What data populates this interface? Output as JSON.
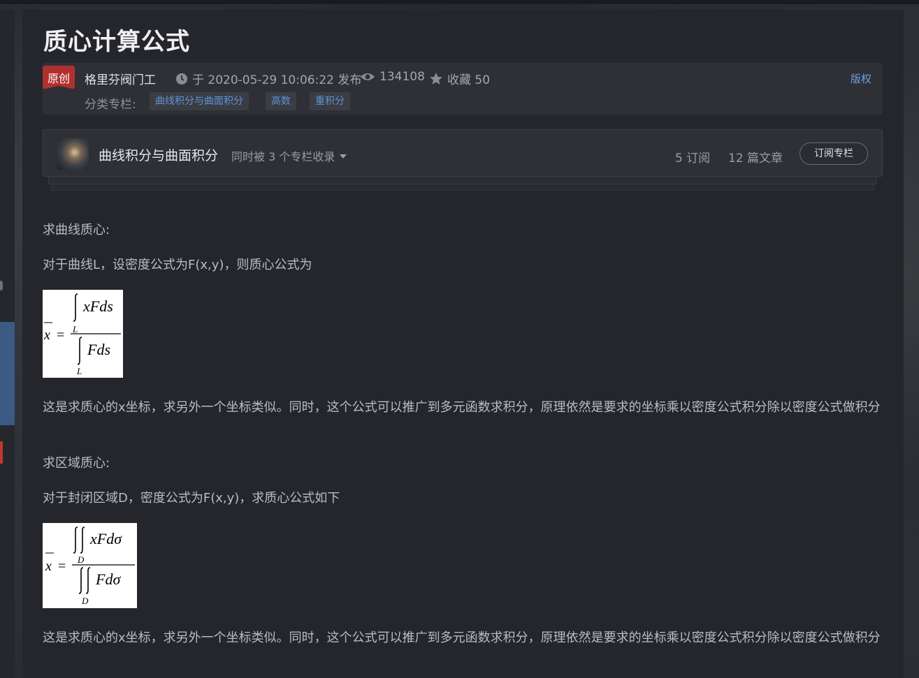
{
  "article": {
    "title": "质心计算公式",
    "meta": {
      "badge": "原创",
      "author": "格里芬阀门工",
      "published": "于 2020-05-29 10:06:22 发布",
      "views": "134108",
      "favorites": "收藏 50",
      "copyright": "版权",
      "category_label": "分类专栏:",
      "tags": [
        "曲线积分与曲面积分",
        "高数",
        "重积分"
      ]
    },
    "column": {
      "name": "曲线积分与曲面积分",
      "also_in": "同时被 3 个专栏收录",
      "subscribers": "5 订阅",
      "articles": "12 篇文章",
      "subscribe_label": "订阅专栏"
    },
    "body": {
      "p1": "求曲线质心:",
      "p2": "对于曲线L，设密度公式为F(x,y)，则质心公式为",
      "p3": "这是求质心的x坐标，求另外一个坐标类似。同时，这个公式可以推广到多元函数求积分，原理依然是要求的坐标乘以密度公式积分除以密度公式做积分",
      "p4": "求区域质心:",
      "p5": "对于封闭区域D，密度公式为F(x,y)，求质心公式如下",
      "p6": "这是求质心的x坐标，求另外一个坐标类似。同时，这个公式可以推广到多元函数求积分，原理依然是要求的坐标乘以密度公式积分除以密度公式做积分"
    },
    "formula1": {
      "lhs": "x",
      "eq": "=",
      "num": "xFds",
      "den": "Fds",
      "sub": "L"
    },
    "formula2": {
      "lhs": "x",
      "eq": "=",
      "num": "xFdσ",
      "den": "Fdσ",
      "sub": "D"
    }
  },
  "colors": {
    "badge": "#b03030",
    "link": "#6ea0e0",
    "tag_text": "#5f93d8",
    "page_bg": "#25262b"
  },
  "icons": [
    "clock-icon",
    "eye-icon",
    "star-icon",
    "caret-down-icon"
  ]
}
